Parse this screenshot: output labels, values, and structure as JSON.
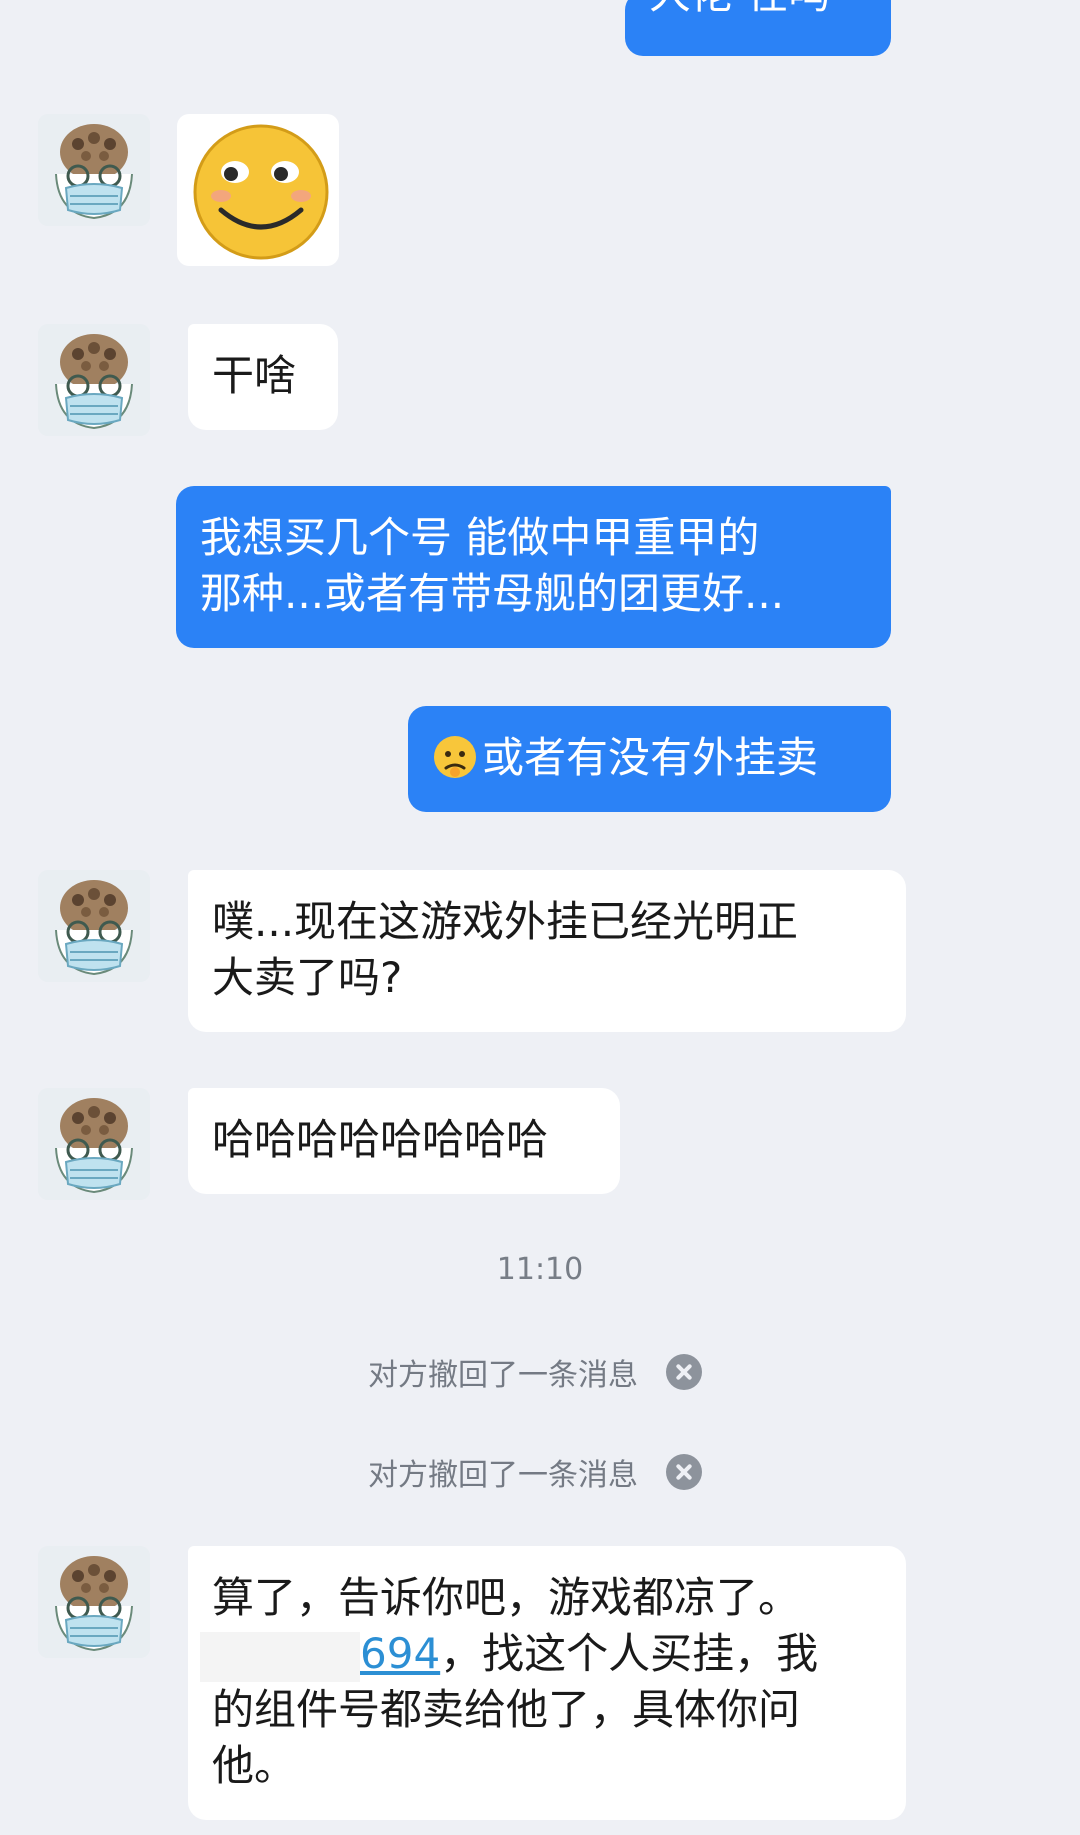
{
  "messages": {
    "top_out_partial": "大佬 在吗",
    "m1_text": "干啥",
    "m2_line1": "我想买几个号  能做中甲重甲的",
    "m2_line2": "那种...或者有带母舰的团更好...",
    "m3_emoji": "worried-face-emoji",
    "m3_text": "或者有没有外挂卖",
    "m4_line1": "噗...现在这游戏外挂已经光明正",
    "m4_line2": "大卖了吗?",
    "m5_text": "哈哈哈哈哈哈哈哈",
    "time": "11:10",
    "recall_1": "对方撤回了一条消息",
    "recall_2": "对方撤回了一条消息",
    "m6_line1": "算了，告诉你吧，游戏都凉了。",
    "m6_link": "694",
    "m6_line2_rest": "，找这个人买挂，我",
    "m6_line3": "的组件号都卖给他了，具体你问",
    "m6_line4": "他。"
  },
  "colors": {
    "background": "#eef0f5",
    "incoming_bubble": "#ffffff",
    "outgoing_bubble": "#2b82f6",
    "link": "#2c8fd4"
  },
  "icons": {
    "avatar": "masked-face-avatar-icon",
    "sticker": "smiley-face-sticker",
    "recall_close": "close-circle-icon"
  }
}
